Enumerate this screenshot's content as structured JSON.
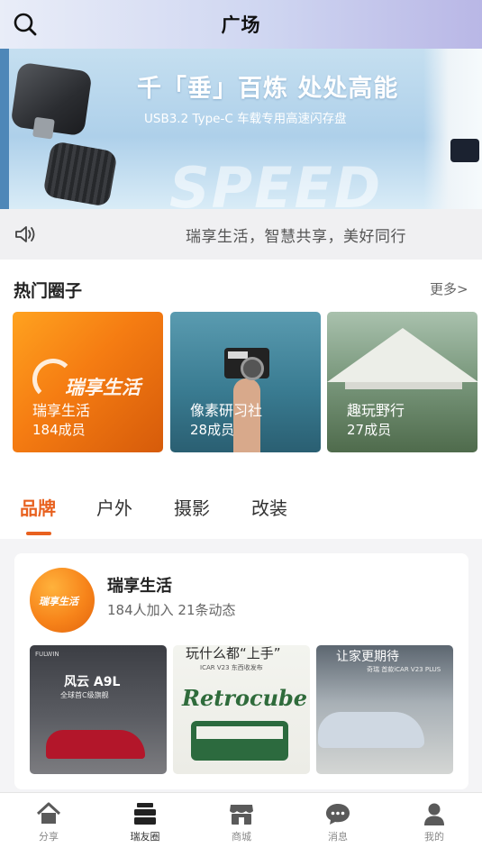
{
  "header": {
    "title": "广场"
  },
  "banner": {
    "headline": "千「垂」百炼  处处高能",
    "sub": "USB3.2 Type-C 车载专用高速闪存盘",
    "watermark": "SPEED"
  },
  "notice": {
    "text": "瑞享生活，智慧共享，美好同行"
  },
  "hot": {
    "title": "热门圈子",
    "more": "更多>",
    "cards": [
      {
        "name": "瑞享生活",
        "count": "184成员",
        "logo": "瑞享生活"
      },
      {
        "name": "像素研习社",
        "count": "28成员"
      },
      {
        "name": "趣玩野行",
        "count": "27成员"
      }
    ]
  },
  "tabs": [
    {
      "label": "品牌",
      "active": true
    },
    {
      "label": "户外"
    },
    {
      "label": "摄影"
    },
    {
      "label": "改装"
    }
  ],
  "feed": {
    "name": "瑞享生活",
    "meta": "184人加入  21条动态",
    "avatar_text": "瑞享生活",
    "thumbs": [
      {
        "brand": "FULWIN",
        "title": "风云 A9L",
        "sub": "全球首C级旗舰"
      },
      {
        "title": "玩什么都“上手”",
        "sub": "ICAR V23 东西收发布",
        "script": "Retrocube"
      },
      {
        "title": "让家更期待",
        "sub": "奇瑞 首款iCAR V23 PLUS"
      }
    ]
  },
  "tabbar": {
    "items": [
      {
        "label": "分享",
        "icon": "home-icon"
      },
      {
        "label": "瑞友圈",
        "icon": "stack-icon",
        "active": true
      },
      {
        "label": "商城",
        "icon": "store-icon"
      },
      {
        "label": "消息",
        "icon": "chat-icon"
      },
      {
        "label": "我的",
        "icon": "person-icon"
      }
    ]
  },
  "colors": {
    "accent": "#e8611f",
    "tab_icon": "#5a5a5a",
    "active_icon": "#222222"
  }
}
